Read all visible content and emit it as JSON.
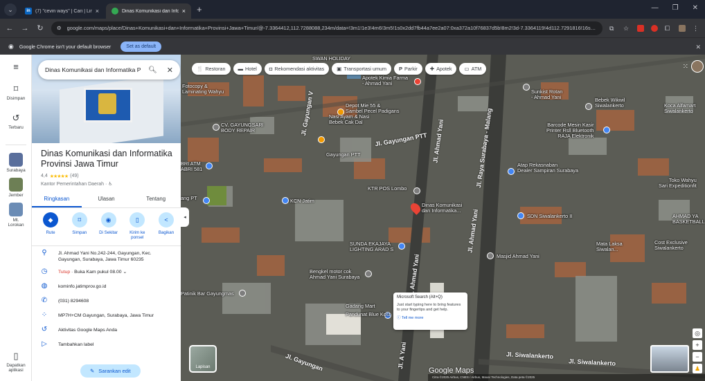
{
  "browser": {
    "tabs": [
      {
        "favicon": "in",
        "title": "(7) \"cevin ways\" | Cari | LinkedIn",
        "active": false
      },
      {
        "favicon": "maps-pin",
        "title": "Dinas Komunikasi dan Informatika",
        "active": true
      }
    ],
    "new_tab": "+",
    "url": "google.com/maps/place/Dinas+Komunikasi+dan+Informatika+Provinsi+Jawa+Timur/@-7.3364412,112.7288088,234m/data=!3m1!1e3!4m6!3m5!1s0x2dd7fb44a7ee2a07:0xa372a10f76837d5b!8m2!3d-7.3364119!4d112.7291816!16s%2Fg%2F...",
    "info_message": "Google Chrome isn't your default browser",
    "set_default_label": "Set as default"
  },
  "rail": {
    "items": [
      {
        "label": "Disimpan",
        "icon": "bookmark-icon"
      },
      {
        "label": "Terbaru",
        "icon": "history-icon"
      },
      {
        "label": "Surabaya"
      },
      {
        "label": "Jember"
      },
      {
        "label": "Mt. Lorokan"
      },
      {
        "label": "Dapatkan aplikasi",
        "icon": "phone-icon"
      }
    ]
  },
  "panel": {
    "search_value": "Dinas Komunikasi dan Informatika P",
    "place_name": "Dinas Komunikasi dan Informatika Provinsi Jawa Timur",
    "rating": "4,4",
    "stars": "★★★★★",
    "reviews": "(49)",
    "category": "Kantor Pemerintahan Daerah · ♿",
    "tabs": [
      "Ringkasan",
      "Ulasan",
      "Tentang"
    ],
    "actions": [
      {
        "label": "Rute",
        "icon": "◆"
      },
      {
        "label": "Simpan",
        "icon": "⌑"
      },
      {
        "label": "Di Sekitar",
        "icon": "◉"
      },
      {
        "label": "Kirim ke ponsel",
        "icon": "▯"
      },
      {
        "label": "Bagikan",
        "icon": "<"
      }
    ],
    "address": "Jl. Ahmad Yani No.242-244, Gayungan, Kec. Gayungan, Surabaya, Jawa Timur 60235",
    "hours_status": "Tutup",
    "hours_rest": " · Buka Kam pukul 08.00",
    "website": "kominfo.jatimprov.go.id",
    "phone": "(031) 8294608",
    "plus_code": "MP7H+CM Gayungan, Surabaya, Jawa Timur",
    "activity": "Aktivitas Google Maps Anda",
    "add_label": "Tambahkan label",
    "suggest_edit": "Sarankan edit"
  },
  "map": {
    "chips": [
      {
        "icon": "🍴",
        "label": "Restoran"
      },
      {
        "icon": "▬",
        "label": "Hotel"
      },
      {
        "icon": "◘",
        "label": "Rekomendasi aktivitas"
      },
      {
        "icon": "▣",
        "label": "Transportasi umum"
      },
      {
        "icon": "P",
        "label": "Parkir"
      },
      {
        "icon": "✚",
        "label": "Apotek"
      },
      {
        "icon": "▭",
        "label": "ATM"
      }
    ],
    "labels": {
      "swan": "SWAN HOLIDAY",
      "kimia": "Apotek Kimia Farma\n- Ahmad Yani",
      "laminating": "Fotocopy &\nLaminating Wahyu",
      "depot": "Depot Mie 55 &\nSambel Pecel Padigans",
      "cv": "CV. GAYUNGSARI\nBODY REPAIR",
      "nasi": "Nasi Ayam & Nasi\nBebek Cak Dal",
      "gayungan_ptt": "Gayungan PTT",
      "atm": "BRI ATM\nABRI 581",
      "pp_pt": "ang PT",
      "ktr_pos": "KTR POS Lombo",
      "kcn": "KCN Jatim",
      "dinas": "Dinas Komunikasi\ndan Informatika...",
      "sunda": "SUNDA EKAJAYA\nLIGHTING ARAD S",
      "bengkel": "Bengkel motor cok\nAhmad Yani Surabaya",
      "gadang": "Gadang Mart",
      "patinik": "Patinik Bar Gayungmas",
      "pandunat": "Pandunat Blue Kost",
      "sunkist": "Sunkist Rotan\n- Ahmad Yani",
      "barcode": "Barcode Mesin Kasir\nPrinter Rsll Bluetooth\nRAJA Elektronik",
      "atap": "Atap Rekasnaban\nDealer Sampiran Surabaya",
      "sdn": "SDN Siwalankerto II",
      "masjid": "Masjid Ahmad Yani",
      "bebek": "Bebek Wikwil\nSiwalankerto",
      "koca": "Koca Alfamart\nSiwalankerto",
      "toko": "Toko Wahyu\nSari Expeditionfit",
      "cost": "Cost Exclusive\nSiwalankerto",
      "mata": "Mata Laksa\nSiwalan...",
      "ahmad_yani_ba": "AHMAD YA\nBASKETBALL"
    },
    "streets": {
      "gayungan_v": "Jl. Gayungan V",
      "gayungan_ptt": "Jl. Gayungan PTT",
      "raya_sby": "Jl. Raya Surabaya - Malang",
      "ahmad_yani_1": "Jl. Ahmad Yani",
      "ahmad_yani_2": "Jl. Ahmad Yani",
      "ahmad_yani_3": "Jl. Ahmad Yani",
      "siwalankerto": "Jl. Siwalankerto",
      "siwalankerto2": "Jl. Siwalankerto",
      "jl_a_yani_bottom": "Jl. A Yani",
      "gayungan_bottom": "Jl. Gayungan"
    },
    "tooltip": {
      "title": "Microsoft Search (Alt+Q)",
      "body": "Just start typing here to bring features to your fingertips and get help.",
      "link": "Tell me more"
    },
    "layer_label": "Lapisan",
    "google_logo": "Google Maps",
    "attribution": "Citra ©2025 Airbus, CNES / Airbus, Maxar Technologies, Data peta ©2025"
  },
  "colors": {
    "accent": "#0b57d0",
    "chip_bg": "#c2e7ff",
    "closed": "#d93025"
  }
}
